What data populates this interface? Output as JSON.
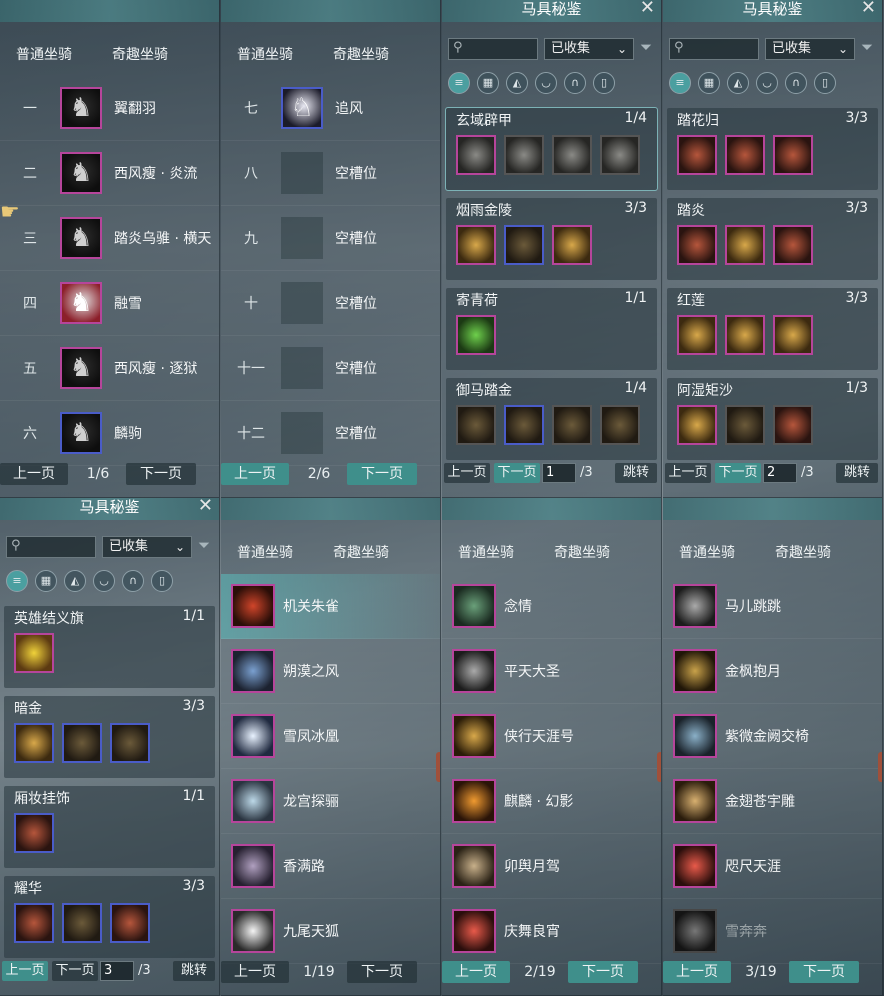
{
  "tabs": {
    "regular": "普通坐骑",
    "fun": "奇趣坐骑"
  },
  "pager": {
    "prev": "上一页",
    "next": "下一页"
  },
  "collection": {
    "title": "马具秘鉴",
    "filter_value": "已收集",
    "jump_label": "跳转",
    "categories": [
      "all-icon",
      "grid-icon",
      "saddle-icon",
      "armor-icon",
      "horseshoe-icon",
      "scroll-icon"
    ]
  },
  "regular_page1": {
    "page_info": "1/6",
    "rows": [
      {
        "num": "一",
        "name": "翼翻羽"
      },
      {
        "num": "二",
        "name": "西风瘦 · 炎流"
      },
      {
        "num": "三",
        "name": "踏炎乌骓 · 横天"
      },
      {
        "num": "四",
        "name": "融雪"
      },
      {
        "num": "五",
        "name": "西风瘦 · 逐狱"
      },
      {
        "num": "六",
        "name": "麟驹"
      }
    ]
  },
  "regular_page2": {
    "page_info": "2/6",
    "rows": [
      {
        "num": "七",
        "name": "追风"
      },
      {
        "num": "八",
        "name": "空槽位"
      },
      {
        "num": "九",
        "name": "空槽位"
      },
      {
        "num": "十",
        "name": "空槽位"
      },
      {
        "num": "十一",
        "name": "空槽位"
      },
      {
        "num": "十二",
        "name": "空槽位"
      }
    ]
  },
  "collection_p1": {
    "page_input": "1",
    "total": "/3",
    "sets": [
      {
        "name": "玄域辟甲",
        "count": "1/4"
      },
      {
        "name": "烟雨金陵",
        "count": "3/3"
      },
      {
        "name": "寄青荷",
        "count": "1/1"
      },
      {
        "name": "御马踏金",
        "count": "1/4"
      }
    ]
  },
  "collection_p2": {
    "page_input": "2",
    "total": "/3",
    "sets": [
      {
        "name": "踏花归",
        "count": "3/3"
      },
      {
        "name": "踏炎",
        "count": "3/3"
      },
      {
        "name": "红莲",
        "count": "3/3"
      },
      {
        "name": "阿湿矩沙",
        "count": "1/3"
      }
    ]
  },
  "collection_p3": {
    "page_input": "3",
    "total": "/3",
    "sets": [
      {
        "name": "英雄结义旗",
        "count": "1/1"
      },
      {
        "name": "暗金",
        "count": "3/3"
      },
      {
        "name": "厢妆挂饰",
        "count": "1/1"
      },
      {
        "name": "耀华",
        "count": "3/3"
      }
    ]
  },
  "fun_page1": {
    "page_info": "1/19",
    "rows": [
      "机关朱雀",
      "朔漠之风",
      "雪凤冰凰",
      "龙宫探骊",
      "香满路",
      "九尾天狐"
    ]
  },
  "fun_page2": {
    "page_info": "2/19",
    "rows": [
      "念情",
      "平天大圣",
      "侠行天涯号",
      "麒麟 · 幻影",
      "卯舆月驾",
      "庆舞良宵"
    ]
  },
  "fun_page3": {
    "page_info": "3/19",
    "rows": [
      "马儿跳跳",
      "金枫抱月",
      "紫微金阙交椅",
      "金翅苍宇雕",
      "咫尺天涯",
      "雪奔奔"
    ]
  }
}
